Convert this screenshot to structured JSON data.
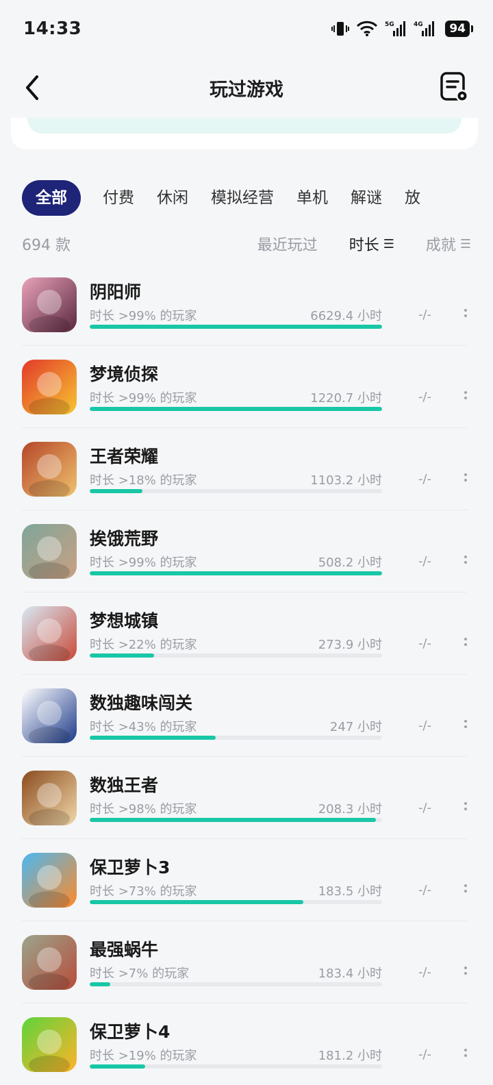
{
  "status": {
    "time": "14:33",
    "battery": "94",
    "signal1": "5G",
    "signal2": "4G"
  },
  "header": {
    "title": "玩过游戏"
  },
  "tabs": [
    "全部",
    "付费",
    "休闲",
    "模拟经营",
    "单机",
    "解谜",
    "放"
  ],
  "summary": {
    "count": "694 款"
  },
  "sorts": [
    {
      "label": "最近玩过",
      "icon": ""
    },
    {
      "label": "时长",
      "icon": "☰"
    },
    {
      "label": "成就",
      "icon": "☰"
    }
  ],
  "games": [
    {
      "name": "阴阳师",
      "rank": "时长 >99% 的玩家",
      "hours": "6629.4 小时",
      "ach": "-/-",
      "percent": 100,
      "icon": "onmyoji-icon",
      "colors": [
        "#e8a2b8",
        "#5a2840"
      ]
    },
    {
      "name": "梦境侦探",
      "rank": "时长 >99% 的玩家",
      "hours": "1220.7 小时",
      "ach": "-/-",
      "percent": 100,
      "icon": "dream-detective-icon",
      "colors": [
        "#e23a2a",
        "#f7c531"
      ]
    },
    {
      "name": "王者荣耀",
      "rank": "时长 >18% 的玩家",
      "hours": "1103.2 小时",
      "ach": "-/-",
      "percent": 18,
      "icon": "honor-of-kings-icon",
      "colors": [
        "#b5462a",
        "#f0c26e"
      ]
    },
    {
      "name": "挨饿荒野",
      "rank": "时长 >99% 的玩家",
      "hours": "508.2 小时",
      "ach": "-/-",
      "percent": 100,
      "icon": "hungry-wild-icon",
      "colors": [
        "#7fa69a",
        "#c9a083"
      ]
    },
    {
      "name": "梦想城镇",
      "rank": "时长 >22% 的玩家",
      "hours": "273.9 小时",
      "ach": "-/-",
      "percent": 22,
      "icon": "dream-town-icon",
      "colors": [
        "#d8e9f5",
        "#c94a38"
      ]
    },
    {
      "name": "数独趣味闯关",
      "rank": "时长 >43% 的玩家",
      "hours": "247 小时",
      "ach": "-/-",
      "percent": 43,
      "icon": "sudoku-fun-icon",
      "colors": [
        "#ffffff",
        "#1e3b8a"
      ]
    },
    {
      "name": "数独王者",
      "rank": "时长 >98% 的玩家",
      "hours": "208.3 小时",
      "ach": "-/-",
      "percent": 98,
      "icon": "sudoku-king-icon",
      "colors": [
        "#8a4b1f",
        "#f1d8a8"
      ]
    },
    {
      "name": "保卫萝卜3",
      "rank": "时长 >73% 的玩家",
      "hours": "183.5 小时",
      "ach": "-/-",
      "percent": 73,
      "icon": "carrot-fantasy-3-icon",
      "colors": [
        "#4ab8f2",
        "#ff8a2a"
      ]
    },
    {
      "name": "最强蜗牛",
      "rank": "时长 >7% 的玩家",
      "hours": "183.4 小时",
      "ach": "-/-",
      "percent": 7,
      "icon": "strongest-snail-icon",
      "colors": [
        "#9aa58c",
        "#b84c3a"
      ]
    },
    {
      "name": "保卫萝卜4",
      "rank": "时长 >19% 的玩家",
      "hours": "181.2 小时",
      "ach": "-/-",
      "percent": 19,
      "icon": "carrot-fantasy-4-icon",
      "colors": [
        "#5ed43c",
        "#ffb32a"
      ]
    }
  ]
}
